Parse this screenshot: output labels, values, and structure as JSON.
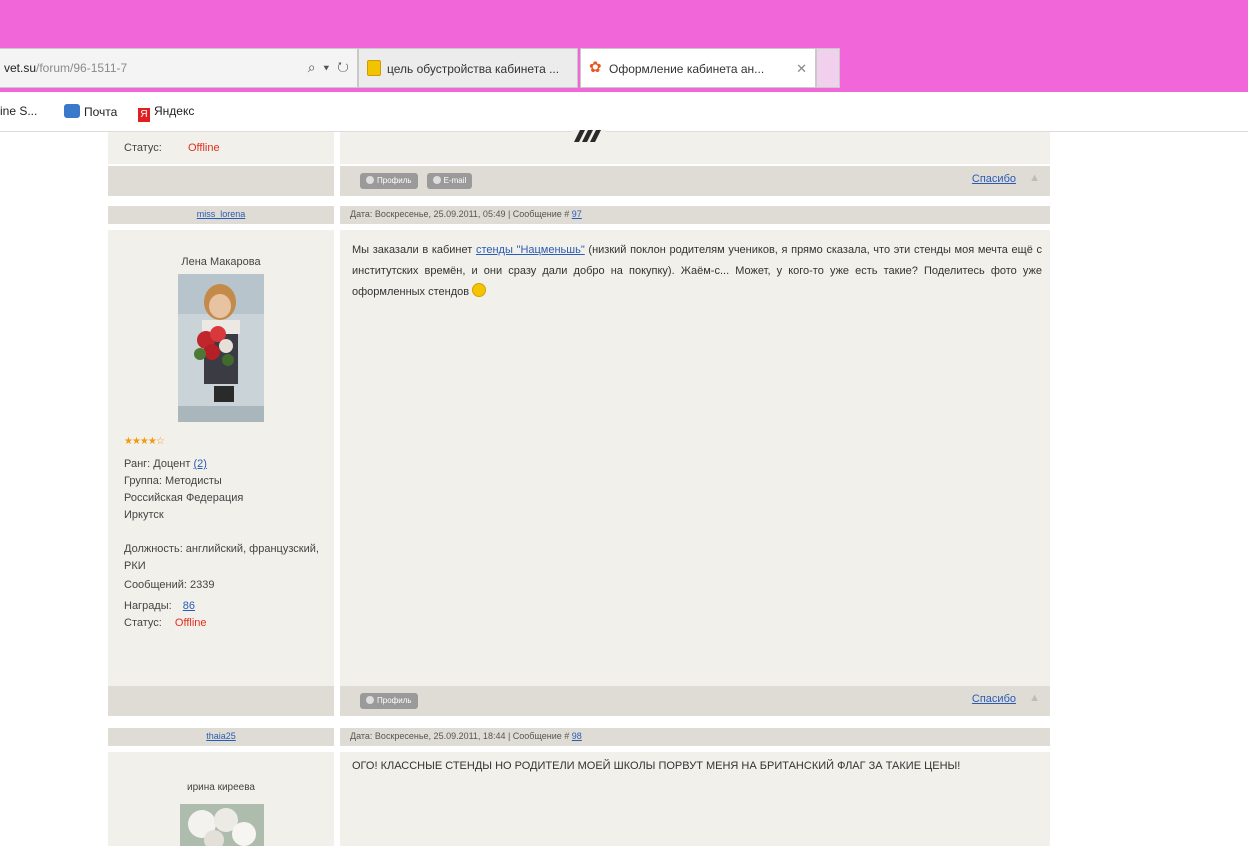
{
  "browser": {
    "address_host": "vet.su",
    "address_path": "/forum/96-1511-7",
    "address_icons": "⌕ ▾ ↻",
    "tabs": [
      {
        "label": "цель обустройства кабинета ...",
        "active": false
      },
      {
        "label": "Оформление кабинета ан...",
        "active": true,
        "close": "✕"
      }
    ],
    "favorites": [
      {
        "label": "ine S..."
      },
      {
        "label": "Почта"
      },
      {
        "label": "Яндекс",
        "icon_letter": "Я"
      }
    ]
  },
  "prev_post": {
    "status_label": "Статус:",
    "status_value": "Offline",
    "buttons": [
      "Профиль",
      "E-mail"
    ],
    "thanks_label": "Спасибо",
    "up_icon": "▲"
  },
  "post1": {
    "nick": "miss_lorena",
    "header": "Дата: Воскресенье, 25.09.2011, 05:49 | Сообщение # ",
    "message_num": "97",
    "user_name": "Лена Макарова",
    "stars": "★★★★☆",
    "rank_label": "Ранг: Доцент",
    "rank_value": "(2)",
    "group": "Группа: Методисты",
    "country": "Российская Федерация",
    "city": "Иркутск",
    "position": "Должность: английский, французский, РКИ",
    "messages": "Сообщений: 2339",
    "awards_label": "Награды:",
    "awards_value": "86",
    "status_label": "Статус:",
    "status_value": "Offline",
    "text_before": "Мы заказали в кабинет ",
    "text_link": "стенды \"Нацменьшь\"",
    "text_after": " (низкий поклон родителям учеников, я прямо сказала, что эти стенды моя мечта ещё с институтских времён, и они сразу дали добро на покупку). Жаём-с... Может, у кого-то уже есть такие? Поделитесь фото уже оформленных стендов",
    "buttons": [
      "Профиль"
    ],
    "thanks_label": "Спасибо",
    "up_icon": "▲"
  },
  "post2": {
    "nick": "thaia25",
    "header": "Дата: Воскресенье, 25.09.2011, 18:44 | Сообщение # ",
    "message_num": "98",
    "user_name": "ирина киреева",
    "text": "ОГО! КЛАССНЫЕ СТЕНДЫ НО РОДИТЕЛИ МОЕЙ ШКОЛЫ ПОРВУТ МЕНЯ НА БРИТАНСКИЙ ФЛАГ ЗА ТАКИЕ ЦЕНЫ!"
  }
}
